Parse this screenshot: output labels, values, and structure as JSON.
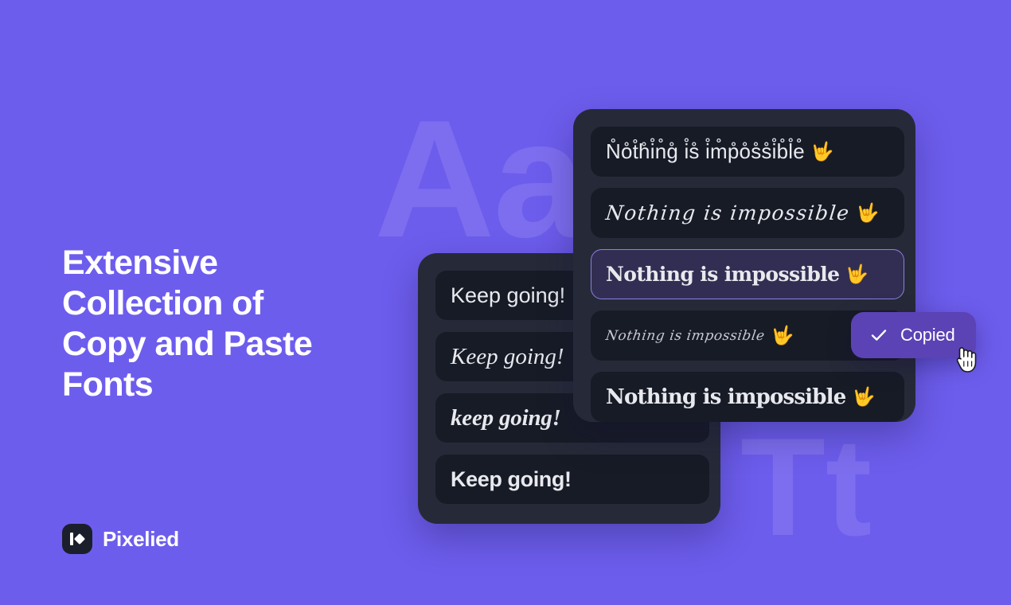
{
  "theme": {
    "background": "#6d5ded",
    "card_bg": "#262a38",
    "row_bg": "#171b26",
    "selected_bg": "#322e53",
    "selected_border": "#8b7fe0",
    "toast_bg": "#5b43b5",
    "text": "#e8e9ee",
    "brand_mark_bg": "#1b1f2b"
  },
  "background_watermarks": {
    "aa": "Aa",
    "tt": "Tt"
  },
  "headline": "Extensive\nCollection of\nCopy and Paste\nFonts",
  "brand": {
    "name": "Pixelied",
    "logo_icon": "pixelied-logo-icon"
  },
  "back_card": {
    "rows": [
      {
        "text": "Keep going!",
        "style": "f-sans",
        "emoji": ""
      },
      {
        "text": "Keep going!",
        "style": "f-brush",
        "emoji": ""
      },
      {
        "text": "keep going!",
        "style": "f-brush-bold",
        "emoji": ""
      },
      {
        "text": "Keep going!",
        "style": "f-sans-bold",
        "emoji": ""
      }
    ]
  },
  "front_card": {
    "rows": [
      {
        "text": "N̊o̊t̊h̊i̊n̊g̊ i̊s̊ i̊m̊p̊o̊s̊s̊i̊b̊l̊e̊",
        "style": "f-ring",
        "emoji": "🤟",
        "selected": false
      },
      {
        "text": "Nothing is impossible",
        "style": "f-script",
        "emoji": "🤟",
        "selected": false
      },
      {
        "text": "Nothing is impossible",
        "style": "f-slab-bold",
        "emoji": "🤟",
        "selected": true
      },
      {
        "text": "Nothing is impossible",
        "style": "f-calligraphy",
        "emoji": "🤟",
        "selected": false
      },
      {
        "text": "Nothing is impossible",
        "style": "f-serif-bold",
        "emoji": "🤟",
        "selected": false
      }
    ]
  },
  "toast": {
    "label": "Copied",
    "icon": "check-icon"
  },
  "cursor": {
    "icon": "pointer-hand-cursor"
  }
}
